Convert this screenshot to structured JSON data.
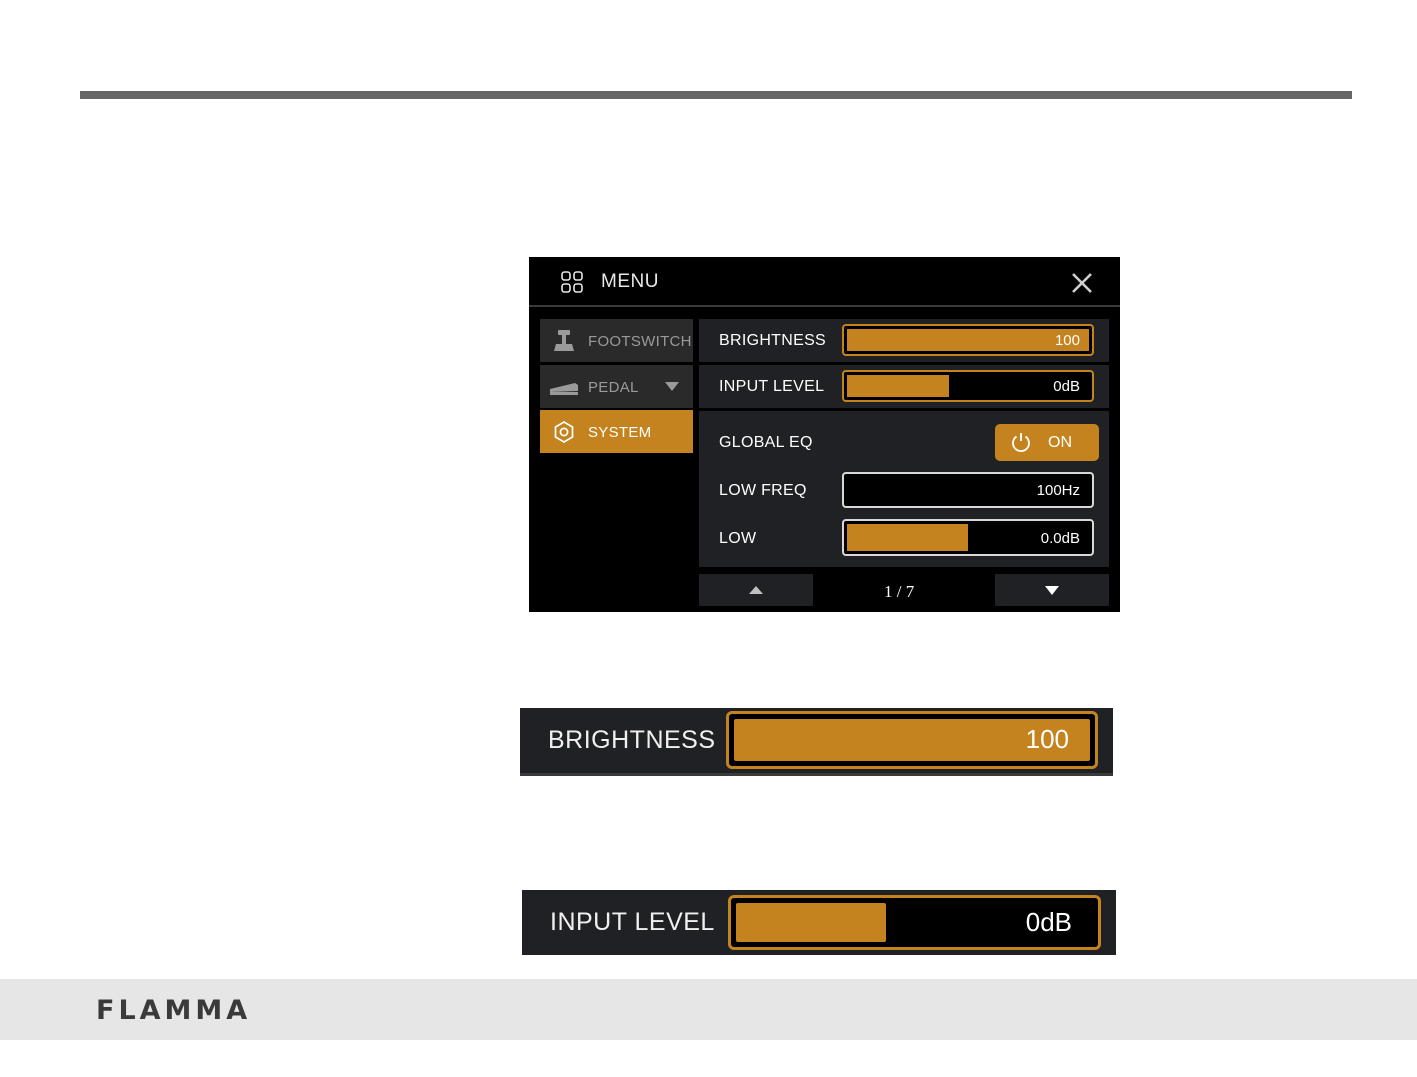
{
  "header": {
    "title": "MENU",
    "menu_icon": "grid-icon",
    "close_icon": "close-icon"
  },
  "sidebar": {
    "items": [
      {
        "label": "FOOTSWITCH",
        "icon": "footswitch-icon",
        "active": false
      },
      {
        "label": "PEDAL",
        "icon": "pedal-icon",
        "active": false,
        "has_dropdown": true
      },
      {
        "label": "SYSTEM",
        "icon": "gear-icon",
        "active": true
      }
    ]
  },
  "settings": {
    "brightness": {
      "label": "BRIGHTNESS",
      "value": "100",
      "level": 1.0
    },
    "input_level": {
      "label": "INPUT LEVEL",
      "value": "0dB",
      "level": 0.42
    },
    "global_eq": {
      "label": "GLOBAL EQ",
      "state": "ON"
    },
    "low_freq": {
      "label": "LOW FREQ",
      "value": "100Hz",
      "level": 0.0
    },
    "low": {
      "label": "LOW",
      "value": "0.0dB",
      "level": 0.5
    }
  },
  "pagination": {
    "text": "1 / 7"
  },
  "zoomed": {
    "brightness": {
      "label": "BRIGHTNESS",
      "value": "100",
      "level": 1.0
    },
    "input_level": {
      "label": "INPUT LEVEL",
      "value": "0dB",
      "level": 0.42
    }
  },
  "footer": {
    "brand": "FLAMMA"
  },
  "colors": {
    "accent": "#c4831e",
    "panel": "#202124",
    "screen_bg": "#000000",
    "footer_bg": "#e6e6e6"
  }
}
